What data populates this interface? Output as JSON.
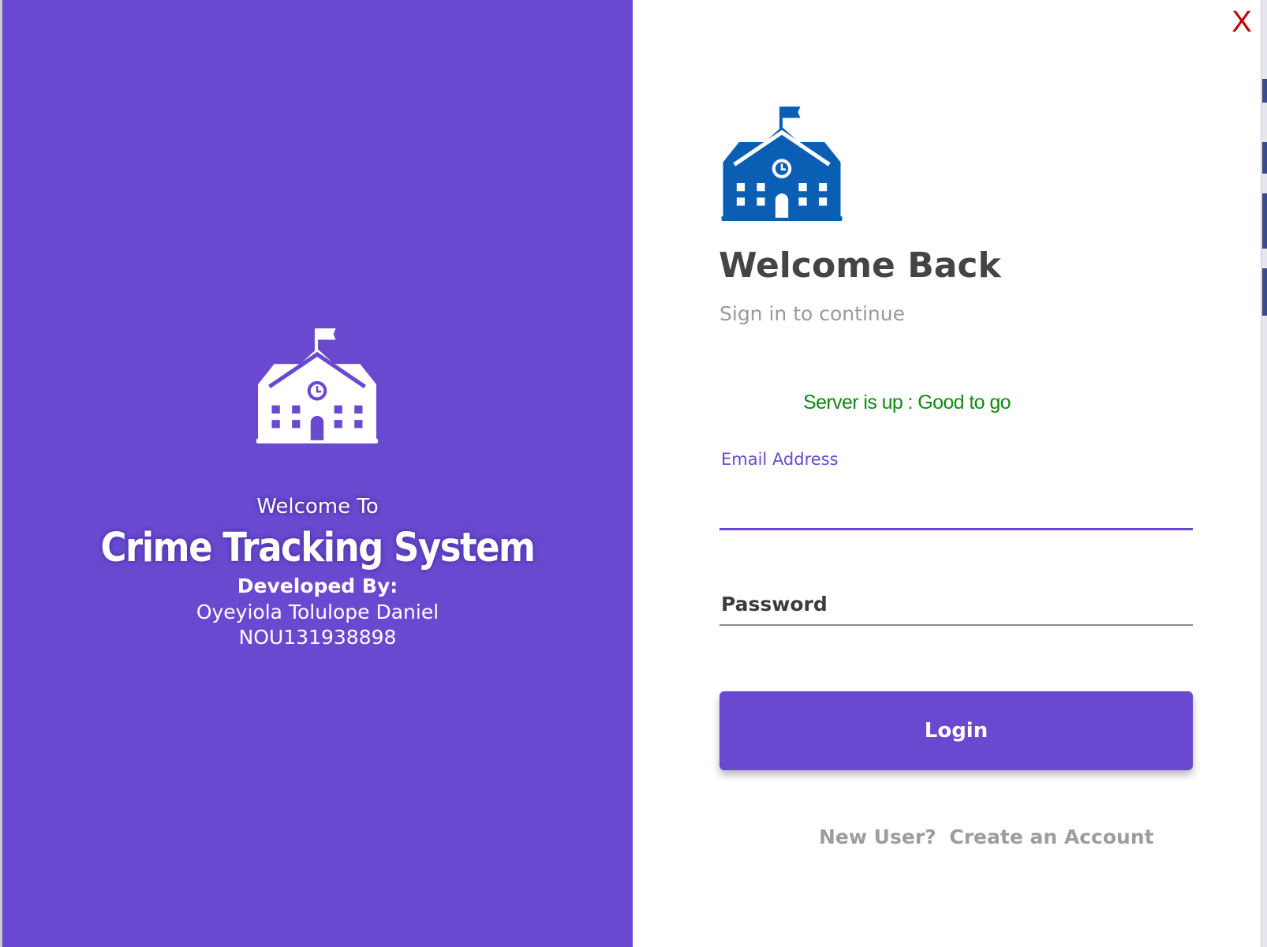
{
  "window": {
    "close_label": "X"
  },
  "brand": {
    "logo_color": "#0a5fb5",
    "panel_color": "#6949cf",
    "icon": "school-building-icon"
  },
  "left_panel": {
    "welcome": "Welcome To",
    "title": "Crime Tracking System",
    "developed_by": "Developed By:",
    "developer_name": "Oyeyiola Tolulope Daniel",
    "developer_id": "NOU131938898"
  },
  "login": {
    "heading": "Welcome Back",
    "subheading": "Sign in to continue",
    "server_status": "Server is up : Good to go",
    "server_status_color": "#118a11",
    "email_label": "Email Address",
    "email_value": "",
    "password_placeholder": "Password",
    "password_value": "",
    "login_button": "Login",
    "new_user_text": "New User?",
    "create_account_link": "Create an Account"
  }
}
